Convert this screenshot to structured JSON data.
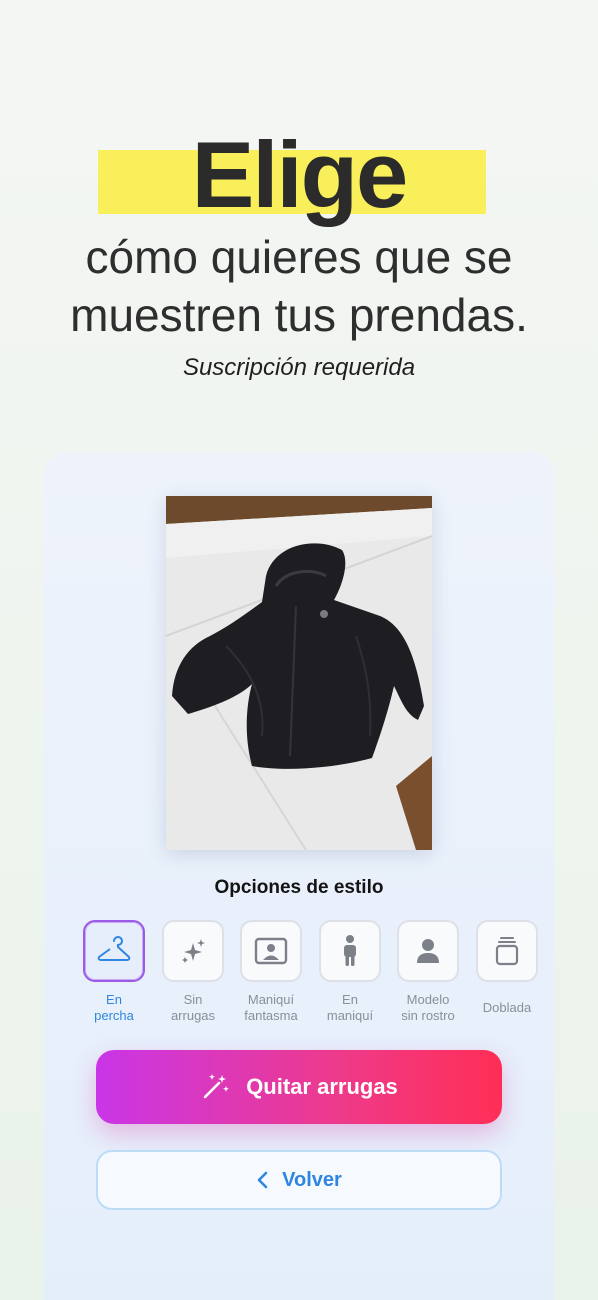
{
  "header": {
    "title": "Elige",
    "subtitle_line1": "cómo quieres que se",
    "subtitle_line2": "muestren tus prendas.",
    "note": "Suscripción requerida"
  },
  "preview": {
    "image_description": "black-jacket-on-white-table"
  },
  "style_options": {
    "title": "Opciones de estilo",
    "items": [
      {
        "label": "En\npercha",
        "icon": "hanger-icon",
        "selected": true
      },
      {
        "label": "Sin\narrugas",
        "icon": "sparkles-icon",
        "selected": false
      },
      {
        "label": "Maniquí\nfantasma",
        "icon": "portrait-frame-icon",
        "selected": false
      },
      {
        "label": "En\nmaniquí",
        "icon": "person-icon",
        "selected": false
      },
      {
        "label": "Modelo\nsin rostro",
        "icon": "user-silhouette-icon",
        "selected": false
      },
      {
        "label": "Doblada",
        "icon": "folded-stack-icon",
        "selected": false
      }
    ]
  },
  "actions": {
    "primary_label": "Quitar arrugas",
    "secondary_label": "Volver"
  },
  "colors": {
    "highlight": "#f8ef5a",
    "accent_blue": "#2f86e0",
    "gradient_start": "#c936e8",
    "gradient_end": "#ff2e56"
  }
}
